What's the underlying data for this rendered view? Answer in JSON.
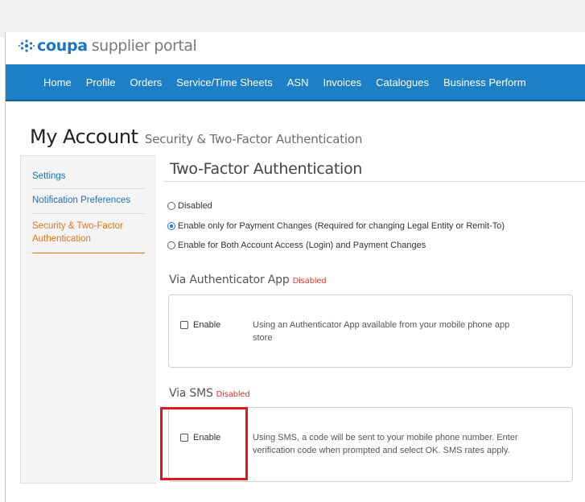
{
  "brand": {
    "name_bold": "coupa",
    "name_rest": "supplier portal",
    "logo_icon": "coupa-snowflake-icon",
    "color": "#1a75c2"
  },
  "nav": {
    "items": [
      "Home",
      "Profile",
      "Orders",
      "Service/Time Sheets",
      "ASN",
      "Invoices",
      "Catalogues",
      "Business Perform"
    ],
    "bg": "#1d7fc6"
  },
  "page": {
    "title": "My Account",
    "subtitle": "Security & Two-Factor Authentication"
  },
  "sidebar": {
    "items": [
      {
        "label": "Settings",
        "active": false
      },
      {
        "label": "Notification Preferences",
        "active": false
      },
      {
        "label_line1": "Security & Two-Factor",
        "label_line2": "Authentication",
        "active": true
      }
    ]
  },
  "two_factor": {
    "heading": "Two-Factor Authentication",
    "options": [
      {
        "label": "Disabled",
        "checked": false
      },
      {
        "label": "Enable only for Payment Changes (Required for changing Legal Entity or Remit-To)",
        "checked": true
      },
      {
        "label": "Enable for Both Account Access (Login) and Payment Changes",
        "checked": false
      }
    ]
  },
  "auth_app": {
    "heading": "Via Authenticator App",
    "status": "Disabled",
    "enable_label": "Enable",
    "enabled": false,
    "desc_line1": "Using an Authenticator App available from your mobile phone app",
    "desc_line2": "store"
  },
  "sms": {
    "heading": "Via SMS",
    "status": "Disabled",
    "enable_label": "Enable",
    "enabled": false,
    "desc_line1": "Using SMS, a code will be sent to your mobile phone number. Enter",
    "desc_line2": "verification code when prompted and select OK. SMS rates apply."
  },
  "colors": {
    "accent_orange": "#e0751c",
    "link_blue": "#1c70b7",
    "status_red": "#d9342b",
    "highlight_red": "#e0161b"
  }
}
